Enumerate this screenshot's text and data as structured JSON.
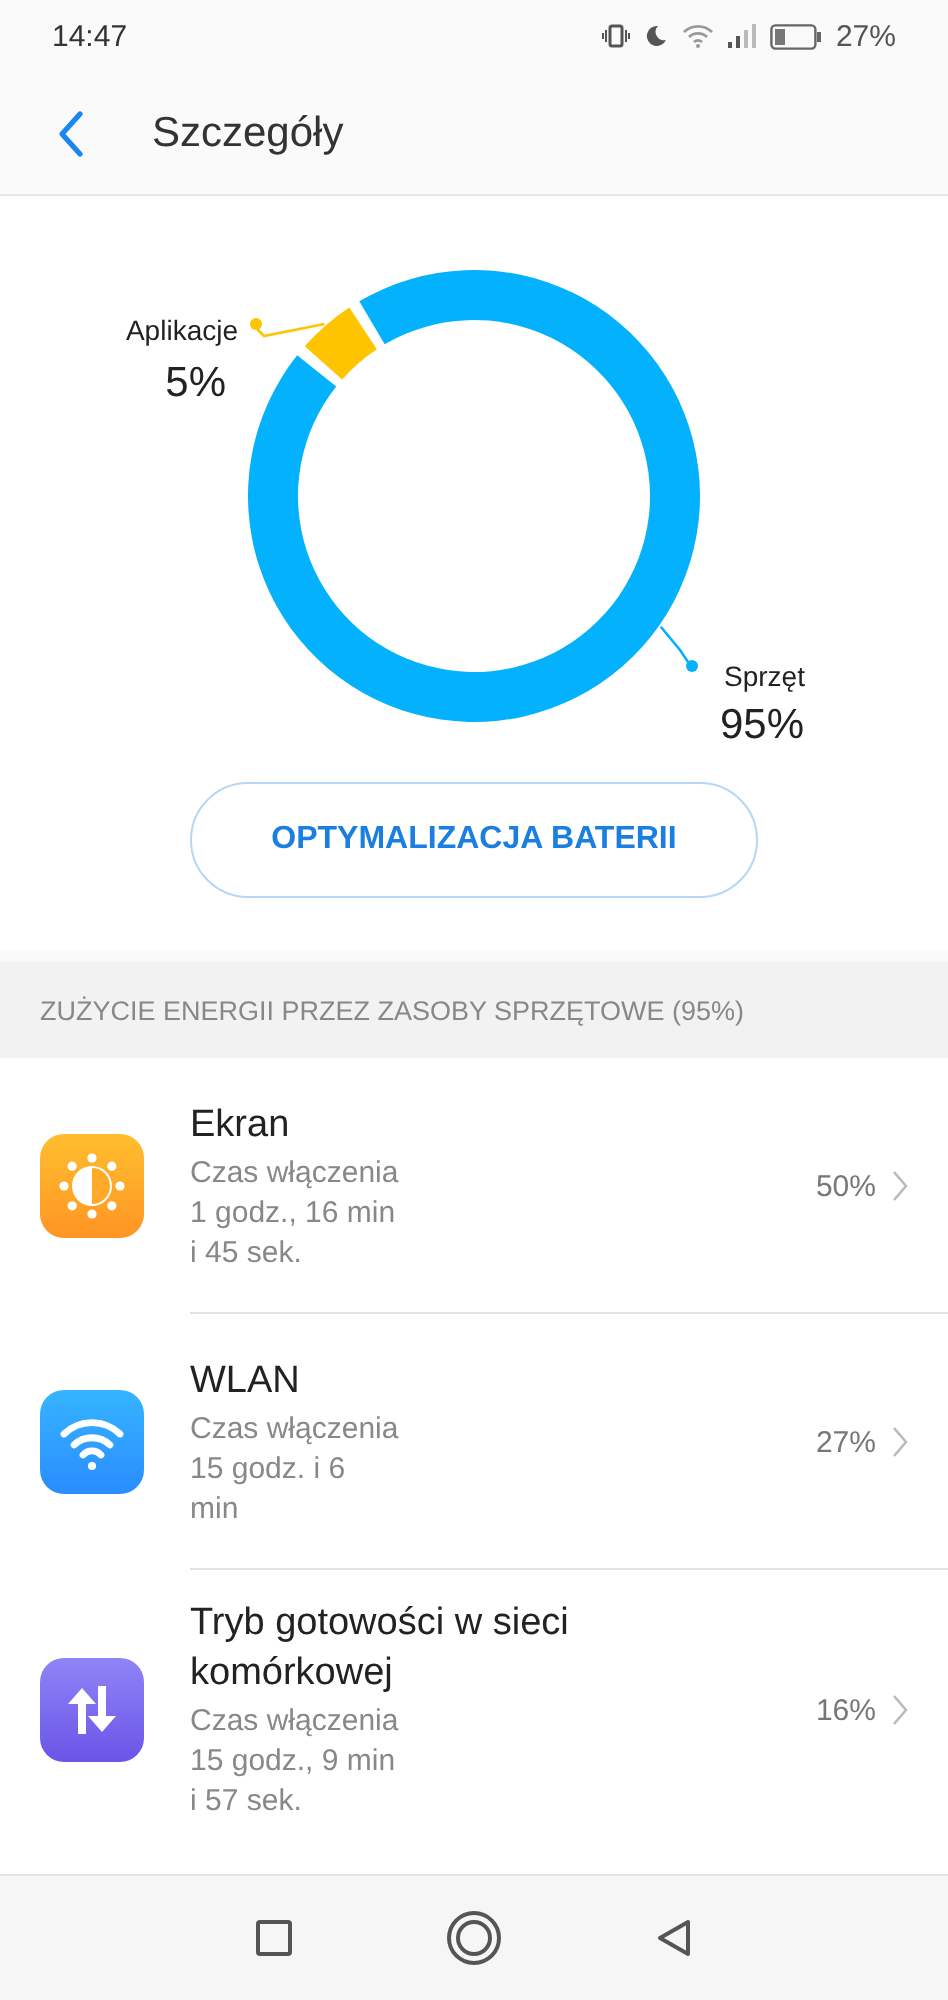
{
  "status_bar": {
    "time": "14:47",
    "battery": "27%"
  },
  "header": {
    "title": "Szczegóły"
  },
  "chart": {
    "chart_data": {
      "type": "donut",
      "categories": [
        "Aplikacje",
        "Sprzęt"
      ],
      "values": [
        5,
        95
      ],
      "value_labels": [
        "5%",
        "95%"
      ]
    }
  },
  "optimize_button": "OPTYMALIZACJA BATERII",
  "section_title": "ZUŻYCIE ENERGII PRZEZ ZASOBY SPRZĘTOWE (95%)",
  "items": [
    {
      "kind": "screen",
      "name": "Ekran",
      "detail_label": "Czas włączenia",
      "detail": [
        "1 godz., 16 min",
        "i 45 sek."
      ],
      "percent": "50%"
    },
    {
      "kind": "wifi",
      "name": "WLAN",
      "detail_label": "Czas włączenia",
      "detail": [
        "15 godz. i 6",
        "min"
      ],
      "percent": "27%"
    },
    {
      "kind": "cellular",
      "name": "Tryb gotowości w sieci komórkowej",
      "detail_label": "Czas włączenia",
      "detail": [
        "15 godz., 9 min",
        "i 57 sek."
      ],
      "percent": "16%"
    }
  ]
}
